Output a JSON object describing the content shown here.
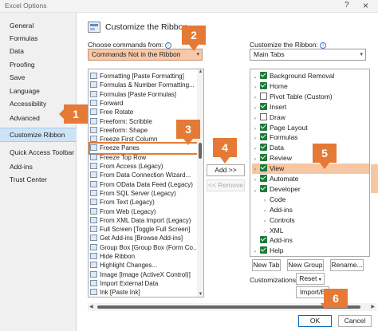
{
  "window": {
    "title": "Excel Options",
    "help": "?",
    "close": "×"
  },
  "categories": [
    {
      "label": "General",
      "selected": false
    },
    {
      "label": "Formulas",
      "selected": false
    },
    {
      "label": "Data",
      "selected": false
    },
    {
      "label": "Proofing",
      "selected": false
    },
    {
      "label": "Save",
      "selected": false
    },
    {
      "label": "Language",
      "selected": false
    },
    {
      "label": "Accessibility",
      "selected": false
    },
    {
      "label": "Advanced",
      "selected": false
    },
    {
      "label": "Customize Ribbon",
      "selected": true
    },
    {
      "label": "Quick Access Toolbar",
      "selected": false
    },
    {
      "label": "Add-ins",
      "selected": false
    },
    {
      "label": "Trust Center",
      "selected": false
    }
  ],
  "header": {
    "title": "Customize the Ribbon",
    "icon": "ribbon-icon"
  },
  "left": {
    "label": "Choose commands from:",
    "dropdown_value": "Commands Not in the Ribbon",
    "commands": [
      "Formatting [Paste Formatting]",
      "Formulas & Number Formatting...",
      "Formulas [Paste Formulas]",
      "Forward",
      "Free Rotate",
      "Freeform: Scribble",
      "Freeform: Shape",
      "Freeze First Column",
      "Freeze Panes",
      "Freeze Top Row",
      "From Access (Legacy)",
      "From Data Connection Wizard...",
      "From OData Data Feed (Legacy)",
      "From SQL Server (Legacy)",
      "From Text (Legacy)",
      "From Web (Legacy)",
      "From XML Data Import (Legacy)",
      "Full Screen [Toggle Full Screen]",
      "Get Add-ins [Browse Add-ins]",
      "Group Box [Group Box (Form Co...",
      "Hide Ribbon",
      "Highlight Changes...",
      "Image [Image (ActiveX Control)]",
      "Import External Data",
      "Ink [Paste Ink]"
    ],
    "selected_index": 8
  },
  "middle": {
    "add": "Add >>",
    "remove": "<< Remove"
  },
  "right": {
    "label": "Customize the Ribbon:",
    "dropdown_value": "Main Tabs",
    "tabs": [
      {
        "label": "Background Removal",
        "checked": true,
        "expander": "open",
        "indent": 0
      },
      {
        "label": "Home",
        "checked": true,
        "expander": "closed",
        "indent": 0
      },
      {
        "label": "Pivot Table (Custom)",
        "checked": false,
        "expander": "closed",
        "indent": 0
      },
      {
        "label": "Insert",
        "checked": true,
        "expander": "closed",
        "indent": 0
      },
      {
        "label": "Draw",
        "checked": false,
        "expander": "closed",
        "indent": 0
      },
      {
        "label": "Page Layout",
        "checked": true,
        "expander": "closed",
        "indent": 0
      },
      {
        "label": "Formulas",
        "checked": true,
        "expander": "closed",
        "indent": 0
      },
      {
        "label": "Data",
        "checked": true,
        "expander": "closed",
        "indent": 0
      },
      {
        "label": "Review",
        "checked": true,
        "expander": "closed",
        "indent": 0
      },
      {
        "label": "View",
        "checked": true,
        "expander": "closed",
        "indent": 0
      },
      {
        "label": "Automate",
        "checked": true,
        "expander": "closed",
        "indent": 0
      },
      {
        "label": "Developer",
        "checked": true,
        "expander": "open",
        "indent": 0
      },
      {
        "label": "Code",
        "checked": null,
        "expander": "closed",
        "indent": 1
      },
      {
        "label": "Add-ins",
        "checked": null,
        "expander": "closed",
        "indent": 1
      },
      {
        "label": "Controls",
        "checked": null,
        "expander": "closed",
        "indent": 1
      },
      {
        "label": "XML",
        "checked": null,
        "expander": "closed",
        "indent": 1
      },
      {
        "label": "Add-ins",
        "checked": true,
        "expander": "none",
        "indent": 0
      },
      {
        "label": "Help",
        "checked": true,
        "expander": "closed",
        "indent": 0
      }
    ],
    "highlighted_index": 9,
    "new_tab": "New Tab",
    "new_group": "New Group",
    "rename": "Rename...",
    "customizations_label": "Customizations:",
    "reset": "Reset",
    "import_export": "Import/E"
  },
  "footer": {
    "ok": "OK",
    "cancel": "Cancel"
  },
  "callouts": [
    "1",
    "2",
    "3",
    "4",
    "5",
    "6"
  ],
  "colors": {
    "callout": "#e47a36",
    "highlight": "#f7c6a2",
    "selected_category": "#cde4f7",
    "checkbox": "#1f7a3a"
  }
}
